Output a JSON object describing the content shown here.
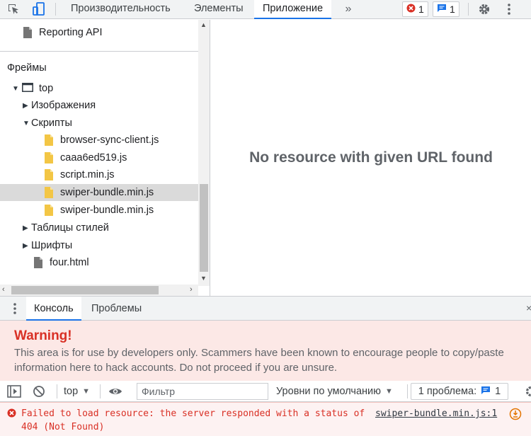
{
  "toolbar": {
    "tabs": [
      {
        "label": "Производительность"
      },
      {
        "label": "Элементы"
      },
      {
        "label": "Приложение",
        "active": true
      }
    ],
    "more_icon": "chevron-double-right-icon",
    "error_count": "1",
    "message_count": "1"
  },
  "tree": {
    "items": [
      {
        "label": "Reporting API",
        "icon": "file-icon-gray",
        "depth": 1
      },
      {
        "label": "top",
        "icon": "frame-icon",
        "depth": 1
      },
      {
        "label": "Изображения",
        "depth": 2
      },
      {
        "label": "Скрипты",
        "depth": 2
      },
      {
        "label": "browser-sync-client.js",
        "icon": "file-icon-yellow",
        "depth": 3
      },
      {
        "label": "caaa6ed519.js",
        "icon": "file-icon-yellow",
        "depth": 3
      },
      {
        "label": "script.min.js",
        "icon": "file-icon-yellow",
        "depth": 3
      },
      {
        "label": "swiper-bundle.min.js",
        "icon": "file-icon-yellow",
        "depth": 3,
        "selected": true
      },
      {
        "label": "swiper-bundle.min.js",
        "icon": "file-icon-yellow",
        "depth": 3
      },
      {
        "label": "Таблицы стилей",
        "depth": 2
      },
      {
        "label": "Шрифты",
        "depth": 2
      },
      {
        "label": "four.html",
        "icon": "file-icon-gray",
        "depth": 2
      }
    ],
    "frames_label": "Фреймы"
  },
  "main": {
    "message": "No resource with given URL found"
  },
  "drawer": {
    "tabs": [
      {
        "label": "Консоль",
        "active": true
      },
      {
        "label": "Проблемы"
      }
    ]
  },
  "warning": {
    "title": "Warning!",
    "body": "This area is for use by developers only. Scammers have been known to encourage people to copy/paste information here to hack accounts. Do not proceed if you are unsure."
  },
  "console_toolbar": {
    "context": "top",
    "filter_placeholder": "Фильтр",
    "levels": "Уровни по умолчанию",
    "issues_label": "1 проблема:",
    "issues_count": "1"
  },
  "console": {
    "error_message": "Failed to load resource: the server responded with a status of 404 (Not Found)",
    "error_source": "swiper-bundle.min.js:1"
  },
  "colors": {
    "accent": "#1a73e8",
    "error": "#d93025",
    "file_yellow": "#f3c645",
    "file_gray": "#757575"
  }
}
